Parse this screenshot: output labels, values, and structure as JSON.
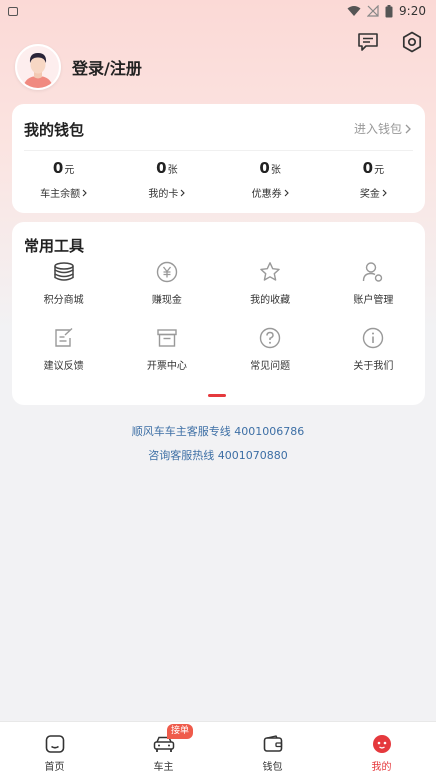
{
  "status_bar": {
    "time": "9:20"
  },
  "header": {
    "login_label": "登录/注册"
  },
  "wallet": {
    "title": "我的钱包",
    "link_label": "进入钱包",
    "stats": [
      {
        "value": "0",
        "unit": "元",
        "label": "车主余额"
      },
      {
        "value": "0",
        "unit": "张",
        "label": "我的卡"
      },
      {
        "value": "0",
        "unit": "张",
        "label": "优惠券"
      },
      {
        "value": "0",
        "unit": "元",
        "label": "奖金"
      }
    ]
  },
  "tools": {
    "title": "常用工具",
    "items": [
      {
        "label": "积分商城",
        "icon": "coins-stack-icon"
      },
      {
        "label": "赚现金",
        "icon": "yuan-coin-icon"
      },
      {
        "label": "我的收藏",
        "icon": "star-icon"
      },
      {
        "label": "账户管理",
        "icon": "user-settings-icon"
      },
      {
        "label": "建议反馈",
        "icon": "feedback-icon"
      },
      {
        "label": "开票中心",
        "icon": "invoice-icon"
      },
      {
        "label": "常见问题",
        "icon": "question-icon"
      },
      {
        "label": "关于我们",
        "icon": "info-icon"
      }
    ]
  },
  "service": {
    "owner_hotline": "顺风车车主客服专线 4001006786",
    "consult_hotline": "咨询客服热线 4001070880"
  },
  "bottom_nav": {
    "items": [
      {
        "label": "首页",
        "icon": "home-icon"
      },
      {
        "label": "车主",
        "icon": "car-icon",
        "badge": "接单"
      },
      {
        "label": "钱包",
        "icon": "wallet-icon"
      },
      {
        "label": "我的",
        "icon": "profile-face-icon",
        "active": true
      }
    ]
  },
  "colors": {
    "accent": "#e5393d",
    "link": "#3d6fa5",
    "header_gradient": "#fbd9d6"
  }
}
